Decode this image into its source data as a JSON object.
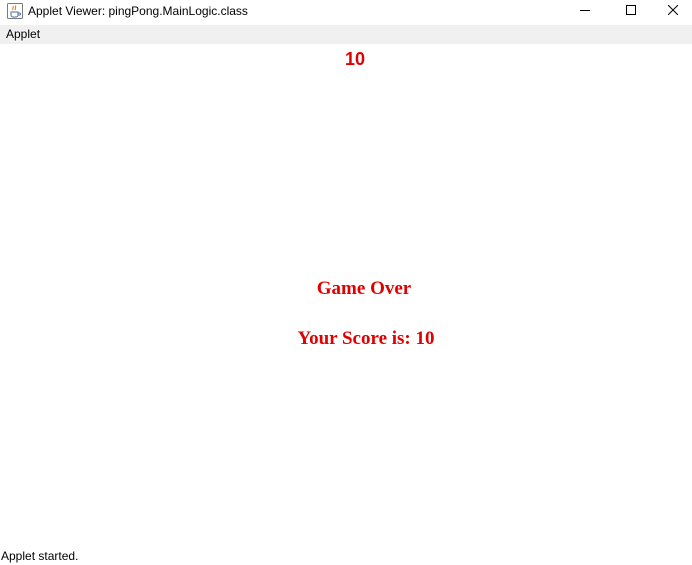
{
  "window": {
    "title": "Applet Viewer: pingPong.MainLogic.class",
    "icon": "java-cup-icon",
    "controls": [
      "minimize-icon",
      "maximize-icon",
      "close-icon"
    ]
  },
  "menubar": {
    "items": [
      {
        "label": "Applet"
      }
    ]
  },
  "game": {
    "score": "10",
    "game_over_text": "Game Over",
    "final_score_text": "Your Score is: 10",
    "text_color": "#e00000"
  },
  "status": {
    "text": "Applet started."
  }
}
